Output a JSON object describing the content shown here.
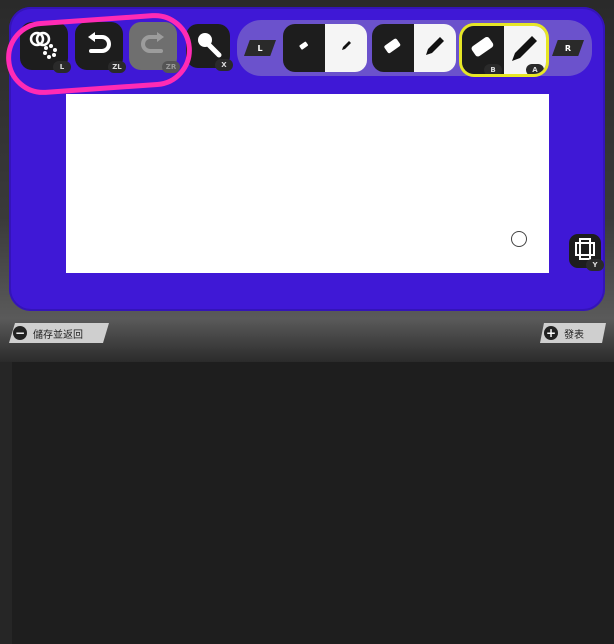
{
  "toolbar": {
    "buttons": [
      {
        "name": "brush-size",
        "badge": "L"
      },
      {
        "name": "undo",
        "badge": "ZL"
      },
      {
        "name": "redo",
        "badge": "ZR",
        "disabled": true
      },
      {
        "name": "zoom",
        "badge": "X"
      }
    ]
  },
  "palette": {
    "shoulder_left": "L",
    "shoulder_right": "R",
    "groups": [
      {
        "size": "small",
        "eraser_badge": "",
        "pen_badge": ""
      },
      {
        "size": "medium",
        "eraser_badge": "",
        "pen_badge": ""
      },
      {
        "size": "large",
        "selected": true,
        "eraser_badge": "B",
        "pen_badge": "A"
      }
    ]
  },
  "side": {
    "layers_badge": "Y"
  },
  "footer": {
    "left": {
      "icon": "−",
      "label": "儲存並返回"
    },
    "right": {
      "icon": "+",
      "label": "發表"
    }
  },
  "colors": {
    "panel": "#3f18d6",
    "palette": "#6b52cc",
    "highlight": "#ff2bb4",
    "selected_outline": "#e6e626"
  }
}
